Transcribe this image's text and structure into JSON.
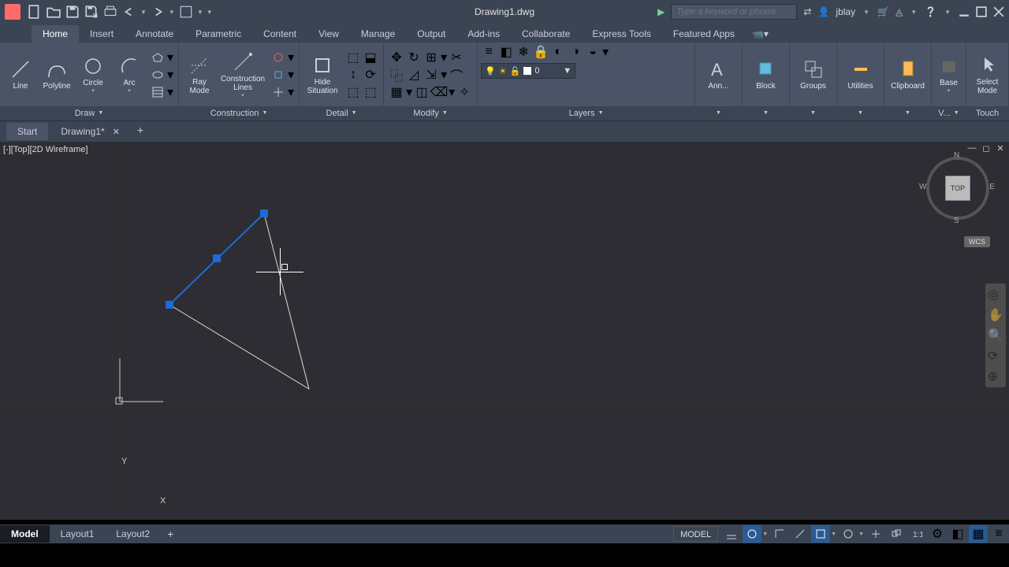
{
  "title": "Drawing1.dwg",
  "search_placeholder": "Type a keyword or phrase",
  "user": "jblay",
  "menu_tabs": [
    "Home",
    "Insert",
    "Annotate",
    "Parametric",
    "Content",
    "View",
    "Manage",
    "Output",
    "Add-ins",
    "Collaborate",
    "Express Tools",
    "Featured Apps"
  ],
  "active_tab": "Home",
  "panels": {
    "draw": {
      "title": "Draw",
      "tools": [
        {
          "label": "Line"
        },
        {
          "label": "Polyline"
        },
        {
          "label": "Circle"
        },
        {
          "label": "Arc"
        }
      ]
    },
    "construction": {
      "title": "Construction",
      "tools": [
        {
          "label": "Ray Mode"
        },
        {
          "label": "Construction Lines"
        }
      ]
    },
    "detail": {
      "title": "Detail",
      "tools": [
        {
          "label": "Hide Situation"
        }
      ]
    },
    "modify": {
      "title": "Modify"
    },
    "layers": {
      "title": "Layers",
      "current": "0"
    },
    "ann": {
      "label": "Ann..."
    },
    "block": {
      "label": "Block"
    },
    "groups": {
      "label": "Groups"
    },
    "utilities": {
      "label": "Utilities"
    },
    "clipboard": {
      "label": "Clipboard"
    },
    "base": {
      "label": "Base"
    },
    "view": {
      "label": "V..."
    },
    "touch": {
      "title": "Touch",
      "label": "Select Mode"
    }
  },
  "file_tabs": [
    {
      "label": "Start"
    },
    {
      "label": "Drawing1*",
      "active": true
    }
  ],
  "viewport_label": "[-][Top][2D Wireframe]",
  "viewcube": {
    "N": "N",
    "S": "S",
    "E": "E",
    "W": "W",
    "face": "TOP"
  },
  "wcs": "WCS",
  "layout_tabs": [
    {
      "label": "Model",
      "active": true
    },
    {
      "label": "Layout1"
    },
    {
      "label": "Layout2"
    }
  ],
  "status": {
    "model": "MODEL"
  },
  "ucs": {
    "y": "Y",
    "x": "X"
  }
}
